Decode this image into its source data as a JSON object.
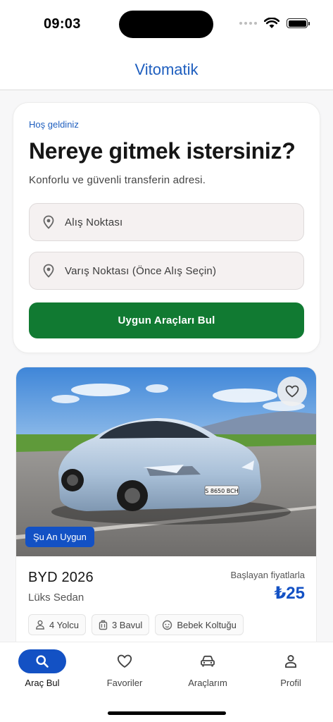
{
  "status_bar": {
    "time": "09:03"
  },
  "header": {
    "title": "Vitomatik"
  },
  "search": {
    "welcome": "Hoş geldiniz",
    "headline": "Nereye gitmek istersiniz?",
    "subtitle": "Konforlu ve güvenli transferin adresi.",
    "pickup_placeholder": "Alış Noktası",
    "dropoff_placeholder": "Varış Noktası (Önce Alış Seçin)",
    "find_button": "Uygun Araçları Bul"
  },
  "vehicle": {
    "badge": "Şu An Uygun",
    "name": "BYD 2026",
    "class": "Lüks Sedan",
    "price_caption": "Başlayan fiyatlarla",
    "price": "₺25",
    "plate": "S 8650 BCH",
    "features": [
      {
        "icon": "person-icon",
        "label": "4 Yolcu"
      },
      {
        "icon": "luggage-icon",
        "label": "3 Bavul"
      },
      {
        "icon": "baby-face-icon",
        "label": "Bebek Koltuğu"
      }
    ]
  },
  "nav": {
    "items": [
      {
        "label": "Araç Bul",
        "icon": "search-icon",
        "active": true
      },
      {
        "label": "Favoriler",
        "icon": "heart-icon",
        "active": false
      },
      {
        "label": "Araçlarım",
        "icon": "car-icon",
        "active": false
      },
      {
        "label": "Profil",
        "icon": "profile-icon",
        "active": false
      }
    ]
  },
  "colors": {
    "primary": "#1351c4",
    "brand_title": "#1f5fbf",
    "cta_green": "#117a32"
  }
}
